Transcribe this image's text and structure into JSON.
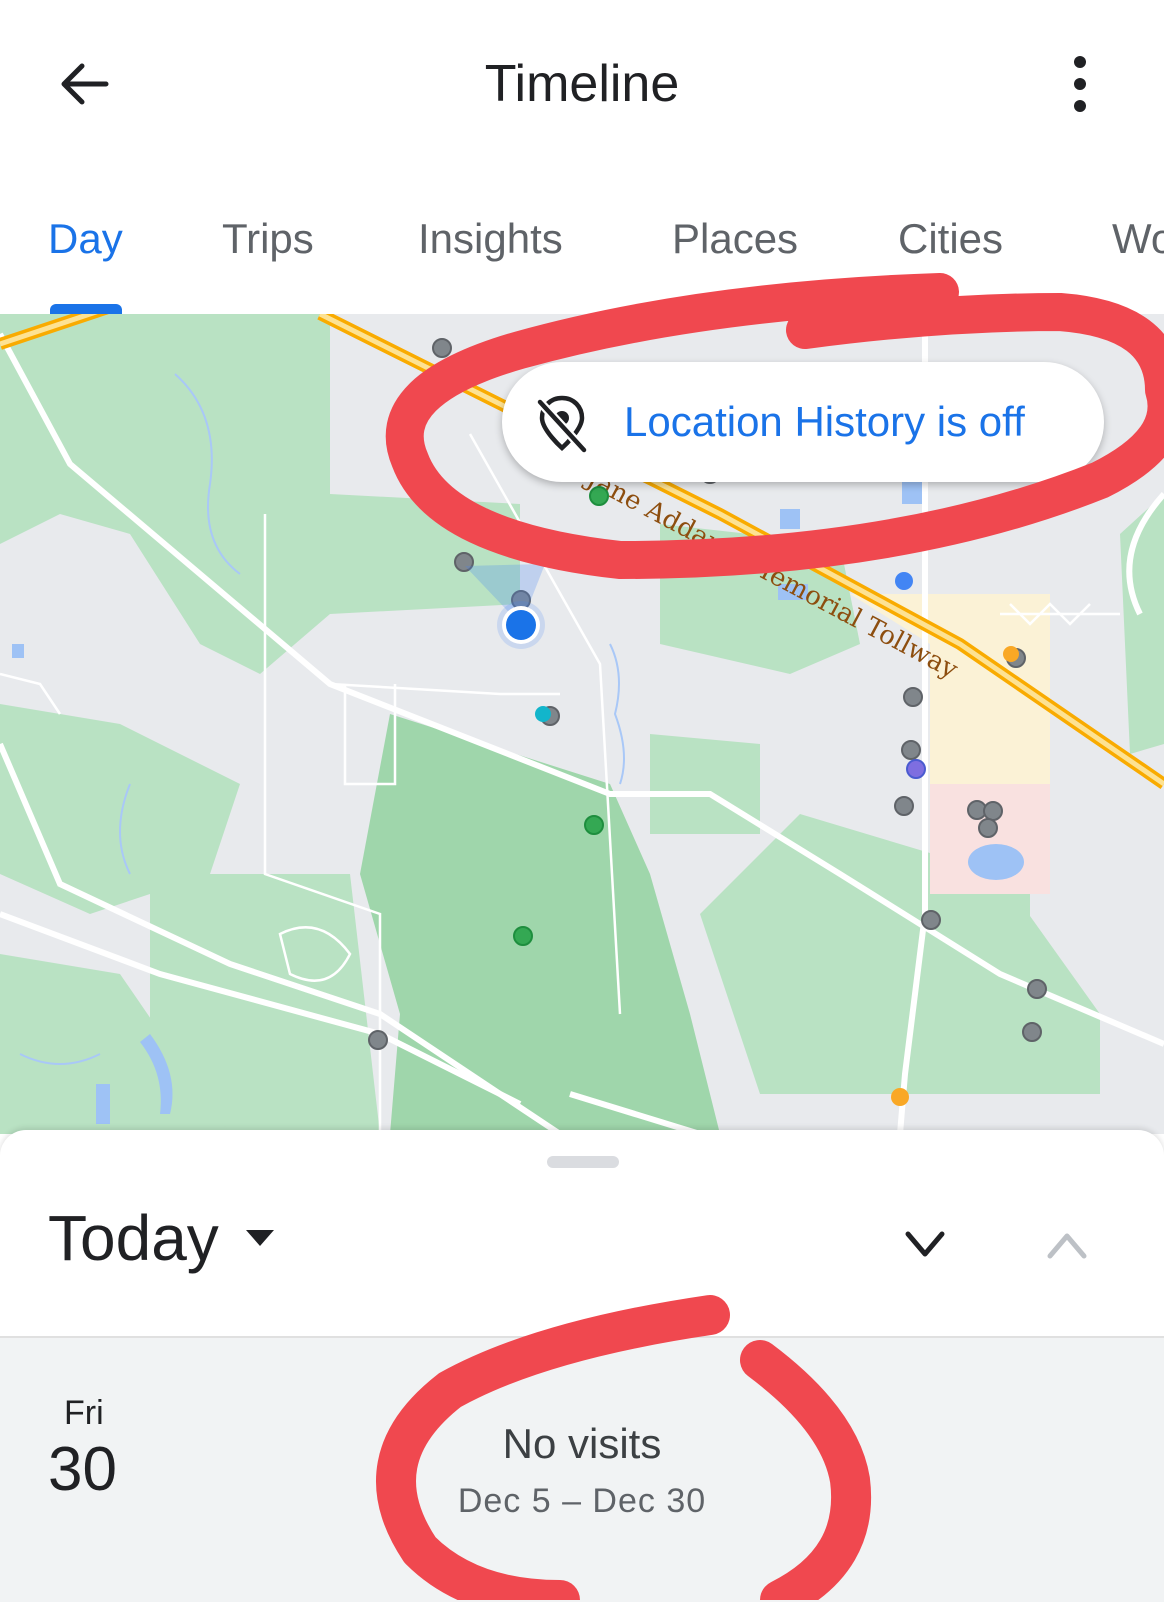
{
  "appbar": {
    "title": "Timeline",
    "back_icon": "arrow-back-icon",
    "more_icon": "more-vertical-icon"
  },
  "tabs": [
    {
      "label": "Day",
      "active": true
    },
    {
      "label": "Trips",
      "active": false
    },
    {
      "label": "Insights",
      "active": false
    },
    {
      "label": "Places",
      "active": false
    },
    {
      "label": "Cities",
      "active": false
    },
    {
      "label": "Wo",
      "active": false
    }
  ],
  "map": {
    "road_label": "Jane Addams Memorial Tollway",
    "location_history": {
      "label": "Location History is off",
      "icon": "location-off-icon"
    }
  },
  "sheet": {
    "period_label": "Today",
    "day": {
      "weekday": "Fri",
      "date": "30",
      "summary": "No visits",
      "range": "Dec 5 – Dec 30"
    }
  },
  "colors": {
    "accent": "#1a73e8",
    "map_green": "#a8dab5",
    "map_dark_green": "#8fd2a0",
    "road_orange": "#f9ab00",
    "annotation_red": "#f0484f"
  }
}
